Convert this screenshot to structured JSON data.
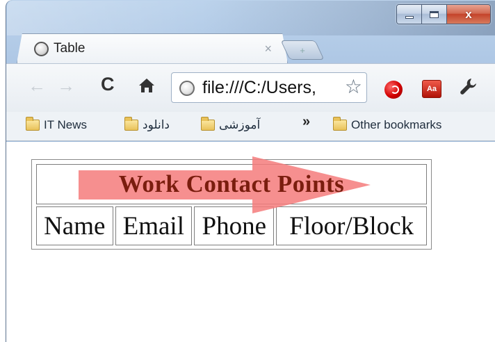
{
  "window": {
    "caption_buttons": {
      "minimize_icon": "minimize-icon",
      "maximize_icon": "maximize-icon",
      "close_icon": "close-icon",
      "close_glyph": "x"
    }
  },
  "tab": {
    "title": "Table",
    "close_glyph": "×",
    "favicon": "page-globe-icon"
  },
  "toolbar": {
    "back_glyph": "←",
    "forward_glyph": "→",
    "reload_glyph": "C",
    "url": "file:///C:/Users,",
    "star_glyph": "☆",
    "acrobat_label": "Aa",
    "wrench_glyph": "🔧"
  },
  "bookmarks": {
    "items": [
      {
        "label": "IT News"
      },
      {
        "label": "دانلود"
      },
      {
        "label": "آموزشی"
      }
    ],
    "overflow_glyph": "»",
    "other": "Other bookmarks"
  },
  "page": {
    "table_title": "Work Contact Points",
    "columns": [
      "Name",
      "Email",
      "Phone",
      "Floor/Block"
    ],
    "accent_color": "#7a1d0e",
    "arrow_color": "#f47b7b"
  }
}
